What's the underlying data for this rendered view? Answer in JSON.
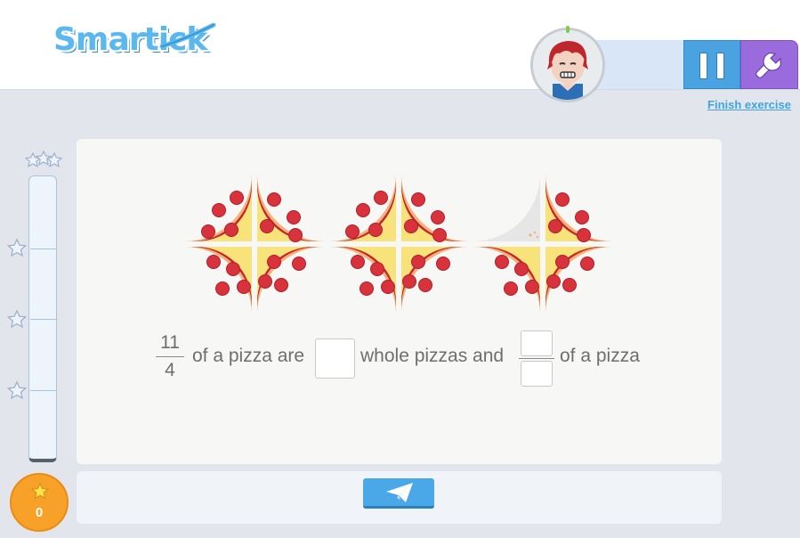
{
  "header": {
    "logo_text": "Smartick",
    "finish_label": "Finish exercise"
  },
  "icons": {
    "pause": "pause-icon",
    "settings": "wrench-icon",
    "send": "paper-plane-icon",
    "star": "star-icon",
    "avatar": "avatar-icon"
  },
  "colors": {
    "pause_bg": "#4aa3e0",
    "settings_bg": "#9a6bdc",
    "score_badge": "#f7a128",
    "link": "#3ea4e3"
  },
  "score": {
    "value": "0"
  },
  "exercise": {
    "fraction_numerator": "11",
    "fraction_denominator": "4",
    "text_1": "of a pizza are",
    "text_2": "whole pizzas and",
    "text_3": "of a pizza",
    "whole_value": "",
    "numerator_value": "",
    "denominator_value": "",
    "pizzas": [
      {
        "slices_present": 4
      },
      {
        "slices_present": 4
      },
      {
        "slices_present": 3
      }
    ]
  }
}
